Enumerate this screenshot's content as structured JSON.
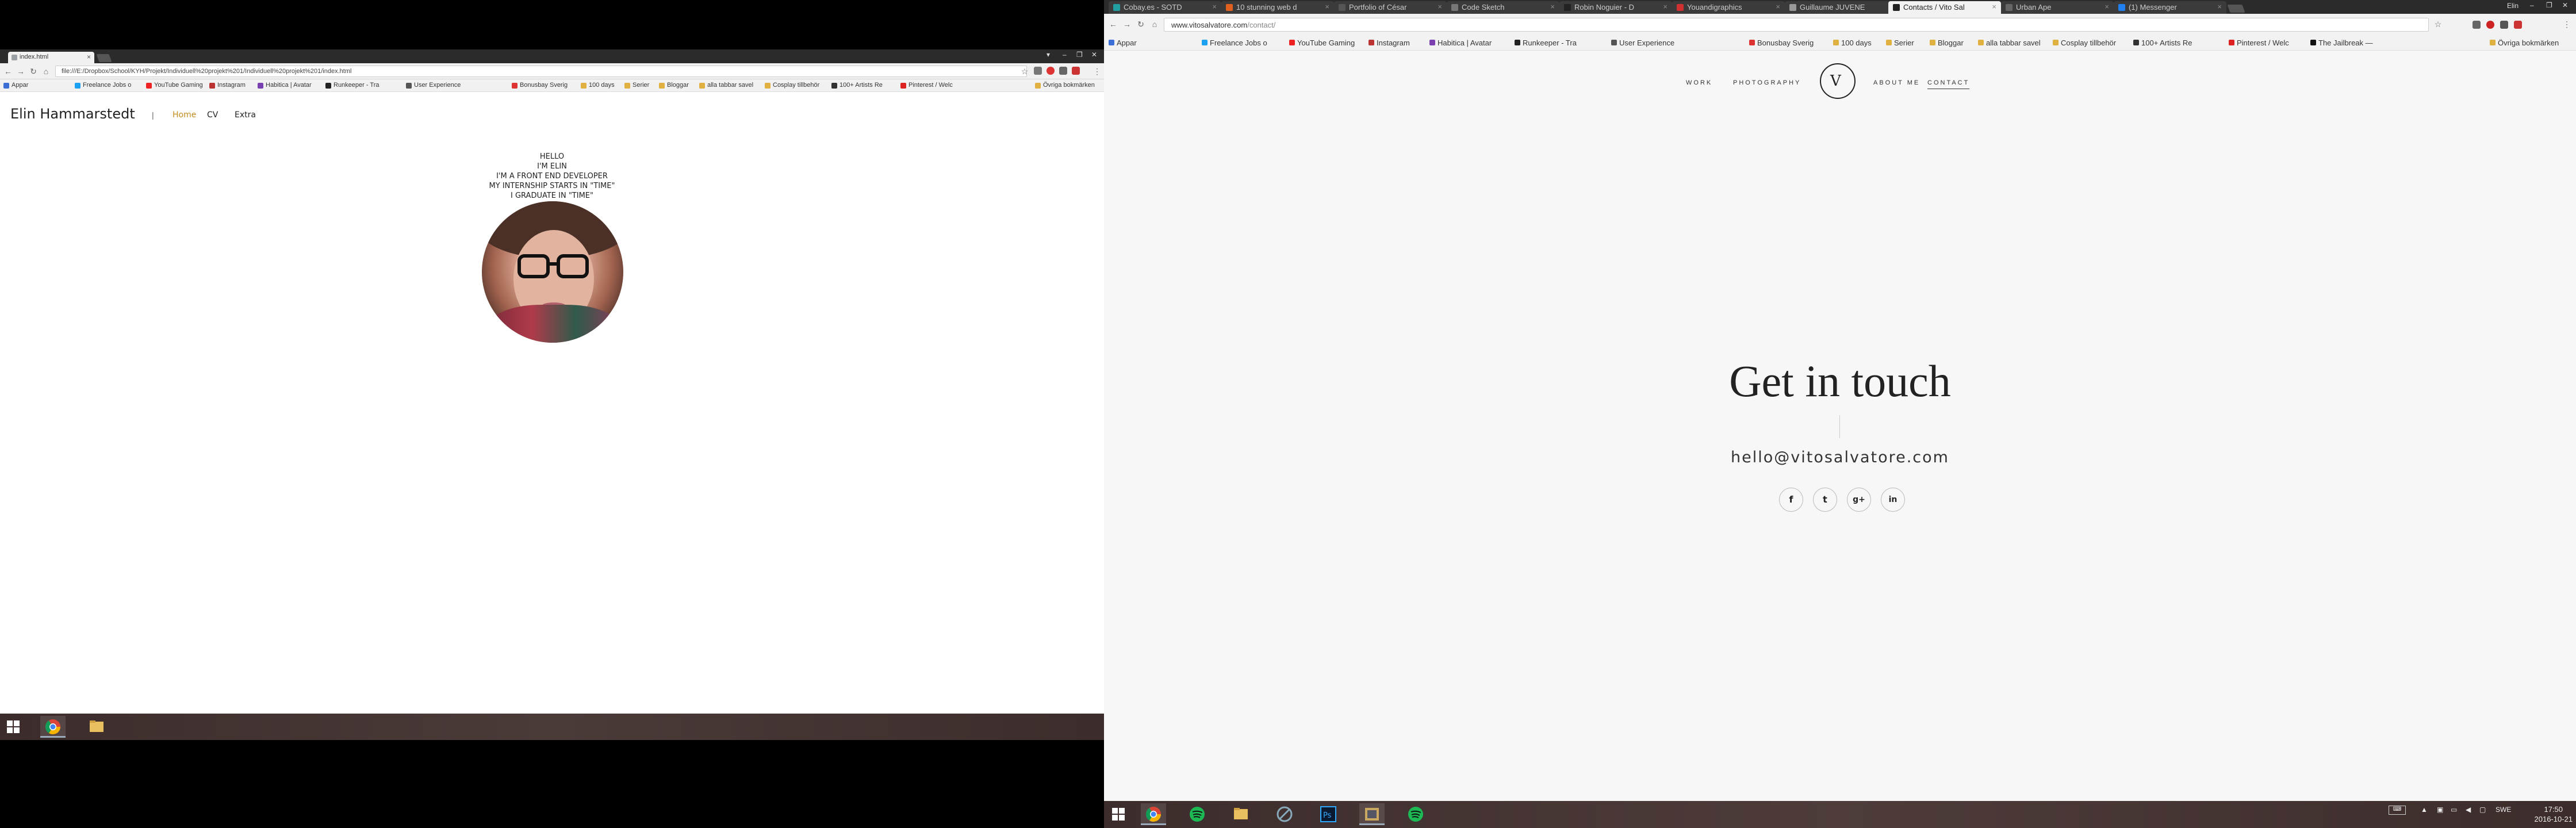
{
  "left": {
    "tab": {
      "title": "index.html"
    },
    "address": "file:///E:/Dropbox/School/KYH/Projekt/Individuell%20projekt%201/Individuell%20projekt%201/index.html",
    "bookmarks": [
      "Appar",
      "Freelance Jobs o",
      "YouTube Gaming",
      "Instagram",
      "Habitica | Avatar",
      "Runkeeper - Tra",
      "User Experience",
      "Bonusbay Sverig",
      "100 days",
      "Serier",
      "Bloggar",
      "alla tabbar savel",
      "Cosplay tillbehör",
      "100+ Artists Re",
      "Pinterest / Welc"
    ],
    "bookmarks_other": "Övriga bokmärken",
    "site_title": "Elin Hammarstedt",
    "nav_sep": "|",
    "nav": [
      {
        "label": "Home"
      },
      {
        "label": "CV"
      },
      {
        "label": "Extra"
      }
    ],
    "intro": [
      "HELLO",
      "I'M ELIN",
      "I'M A FRONT END DEVELOPER",
      "MY INTERNSHIP STARTS IN \"TIME\"",
      "I GRADUATE IN \"TIME\""
    ]
  },
  "right": {
    "tabs": [
      {
        "title": "Cobay.es - SOTD",
        "color": "#20a0a0"
      },
      {
        "title": "10 stunning web d",
        "color": "#e06020"
      },
      {
        "title": "Portfolio of César",
        "color": "#555555"
      },
      {
        "title": "Code Sketch",
        "color": "#777777"
      },
      {
        "title": "Robin Noguier - D",
        "color": "#222222"
      },
      {
        "title": "Youandigraphics",
        "color": "#d03030"
      },
      {
        "title": "Guillaume JUVENE",
        "color": "#999999"
      },
      {
        "title": "Contacts / Vito Sal",
        "color": "#222222"
      },
      {
        "title": "Urban Ape",
        "color": "#666666"
      },
      {
        "title": "(1) Messenger",
        "color": "#2080f0"
      }
    ],
    "active_tab": 7,
    "user": "Elin",
    "address_host": "www.vitosalvatore.com",
    "address_path": "/contact/",
    "bookmarks": [
      "Appar",
      "Freelance Jobs o",
      "YouTube Gaming",
      "Instagram",
      "Habitica | Avatar",
      "Runkeeper - Tra",
      "User Experience",
      "Bonusbay Sverig",
      "100 days",
      "Serier",
      "Bloggar",
      "alla tabbar savel",
      "Cosplay tillbehör",
      "100+ Artists Re",
      "Pinterest / Welc",
      "The Jailbreak — "
    ],
    "bookmarks_other": "Övriga bokmärken",
    "nav": [
      {
        "label": "WORK"
      },
      {
        "label": "PHOTOGRAPHY"
      },
      {
        "label": "ABOUT ME"
      },
      {
        "label": "CONTACT"
      }
    ],
    "logo_glyph": "V",
    "headline": "Get in touch",
    "email": "hello@vitosalvatore.com",
    "social": [
      {
        "icon": "facebook-icon",
        "glyph": "f"
      },
      {
        "icon": "twitter-icon",
        "glyph": "t"
      },
      {
        "icon": "google-plus-icon",
        "glyph": "g+"
      },
      {
        "icon": "linkedin-icon",
        "glyph": "in"
      }
    ],
    "tray": {
      "lang": "SWE",
      "time": "17:50",
      "date": "2016-10-21"
    }
  },
  "colors": {
    "accent_nav_left": "#c48a1e",
    "taskbar": "#3c2c2b",
    "page_bg_right": "#f7f7f7"
  }
}
